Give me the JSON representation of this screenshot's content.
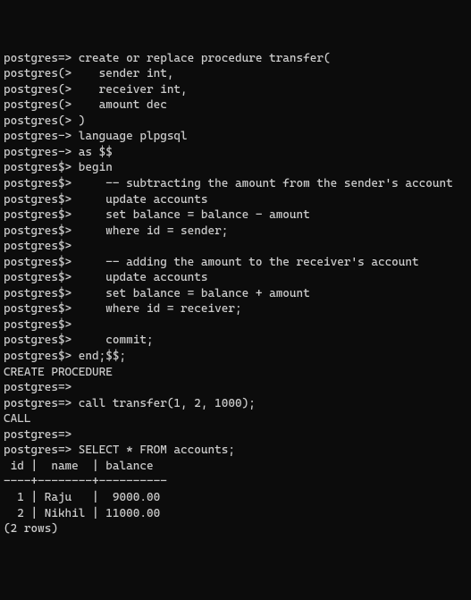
{
  "lines": [
    "postgres=> create or replace procedure transfer(",
    "postgres(>    sender int,",
    "postgres(>    receiver int,",
    "postgres(>    amount dec",
    "postgres(> )",
    "postgres-> language plpgsql",
    "postgres-> as $$",
    "postgres$> begin",
    "postgres$>     -- subtracting the amount from the sender's account",
    "postgres$>     update accounts",
    "postgres$>     set balance = balance - amount",
    "postgres$>     where id = sender;",
    "postgres$>",
    "postgres$>     -- adding the amount to the receiver's account",
    "postgres$>     update accounts",
    "postgres$>     set balance = balance + amount",
    "postgres$>     where id = receiver;",
    "postgres$>",
    "postgres$>     commit;",
    "postgres$> end;$$;",
    "CREATE PROCEDURE",
    "postgres=>",
    "postgres=> call transfer(1, 2, 1000);",
    "CALL",
    "postgres=>",
    "postgres=> SELECT * FROM accounts;",
    " id |  name  | balance",
    "----+--------+----------",
    "  1 | Raju   |  9000.00",
    "  2 | Nikhil | 11000.00",
    "(2 rows)"
  ]
}
